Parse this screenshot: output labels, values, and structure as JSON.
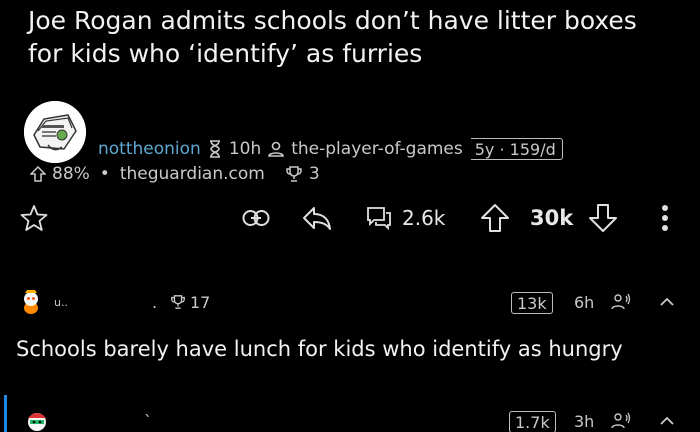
{
  "post": {
    "title": "Joe Rogan admits schools don’t have litter boxes for kids who ‘identify’ as furries",
    "subreddit": "nottheonion",
    "age": "10h",
    "author": "the-player-of-games",
    "author_flair": "5y · 159/d",
    "upvote_ratio": "88%",
    "domain": "theguardian.com",
    "awards": "3",
    "comments_count": "2.6k",
    "score": "30k"
  },
  "comments": [
    {
      "author": "u..",
      "author_tail": ".",
      "awards": "17",
      "votes": "13k",
      "age": "6h",
      "body": "Schools barely have lunch for kids who identify as hungry"
    },
    {
      "author_tail": "`",
      "votes": "1.7k",
      "age": "3h"
    }
  ],
  "colors": {
    "background": "#000000",
    "subreddit": "#5fa8d3",
    "text": "#f2f2f2",
    "meta": "#c9c9c9",
    "thread_line": "#1e88e5"
  }
}
